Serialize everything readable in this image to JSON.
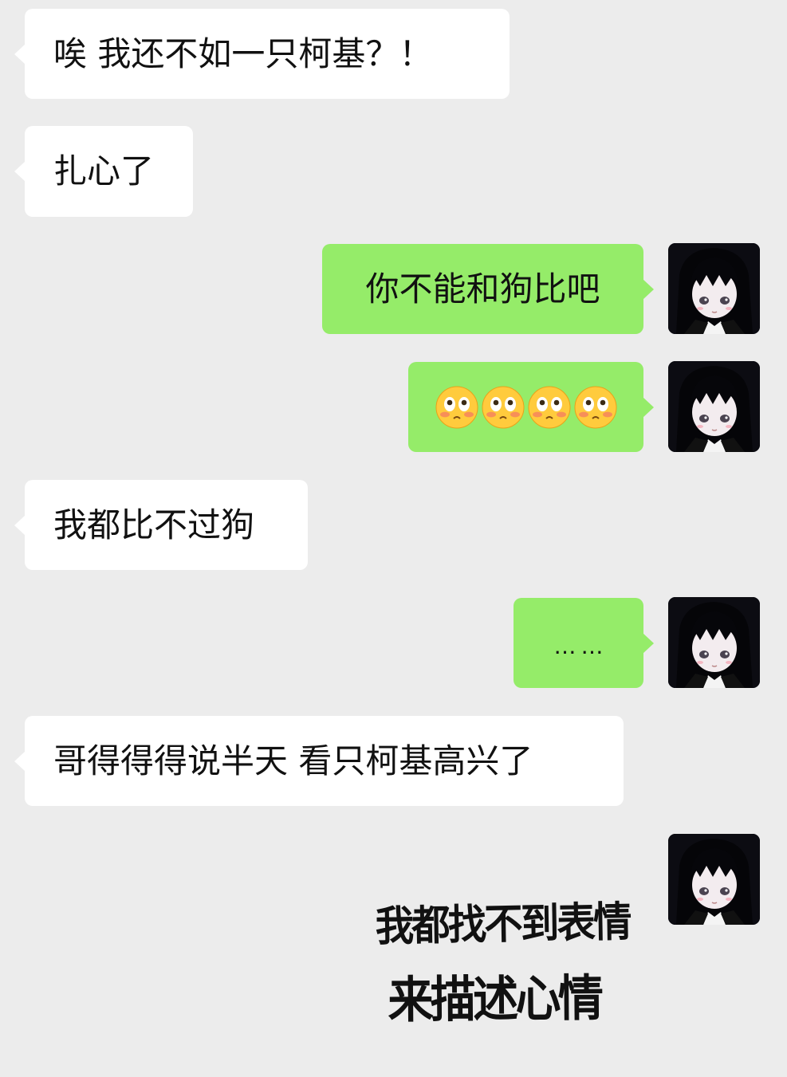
{
  "colors": {
    "background": "#ececec",
    "incoming_bubble": "#ffffff",
    "outgoing_bubble": "#95ec69",
    "text": "#111111"
  },
  "messages": [
    {
      "side": "left",
      "text": "唉 我还不如一只柯基？！"
    },
    {
      "side": "left",
      "text": "扎心了"
    },
    {
      "side": "right",
      "text": "你不能和狗比吧"
    },
    {
      "side": "right",
      "type": "emoji",
      "emojis": [
        "flushed-face",
        "flushed-face",
        "flushed-face",
        "flushed-face"
      ]
    },
    {
      "side": "left",
      "text": "我都比不过狗"
    },
    {
      "side": "right",
      "text": "……"
    },
    {
      "side": "left",
      "text": "哥得得得说半天 看只柯基高兴了"
    },
    {
      "side": "right",
      "type": "sticker",
      "lines": [
        "我都找不到表情",
        "来描述心情"
      ]
    }
  ],
  "avatar": {
    "icon": "anime-girl-avatar"
  }
}
